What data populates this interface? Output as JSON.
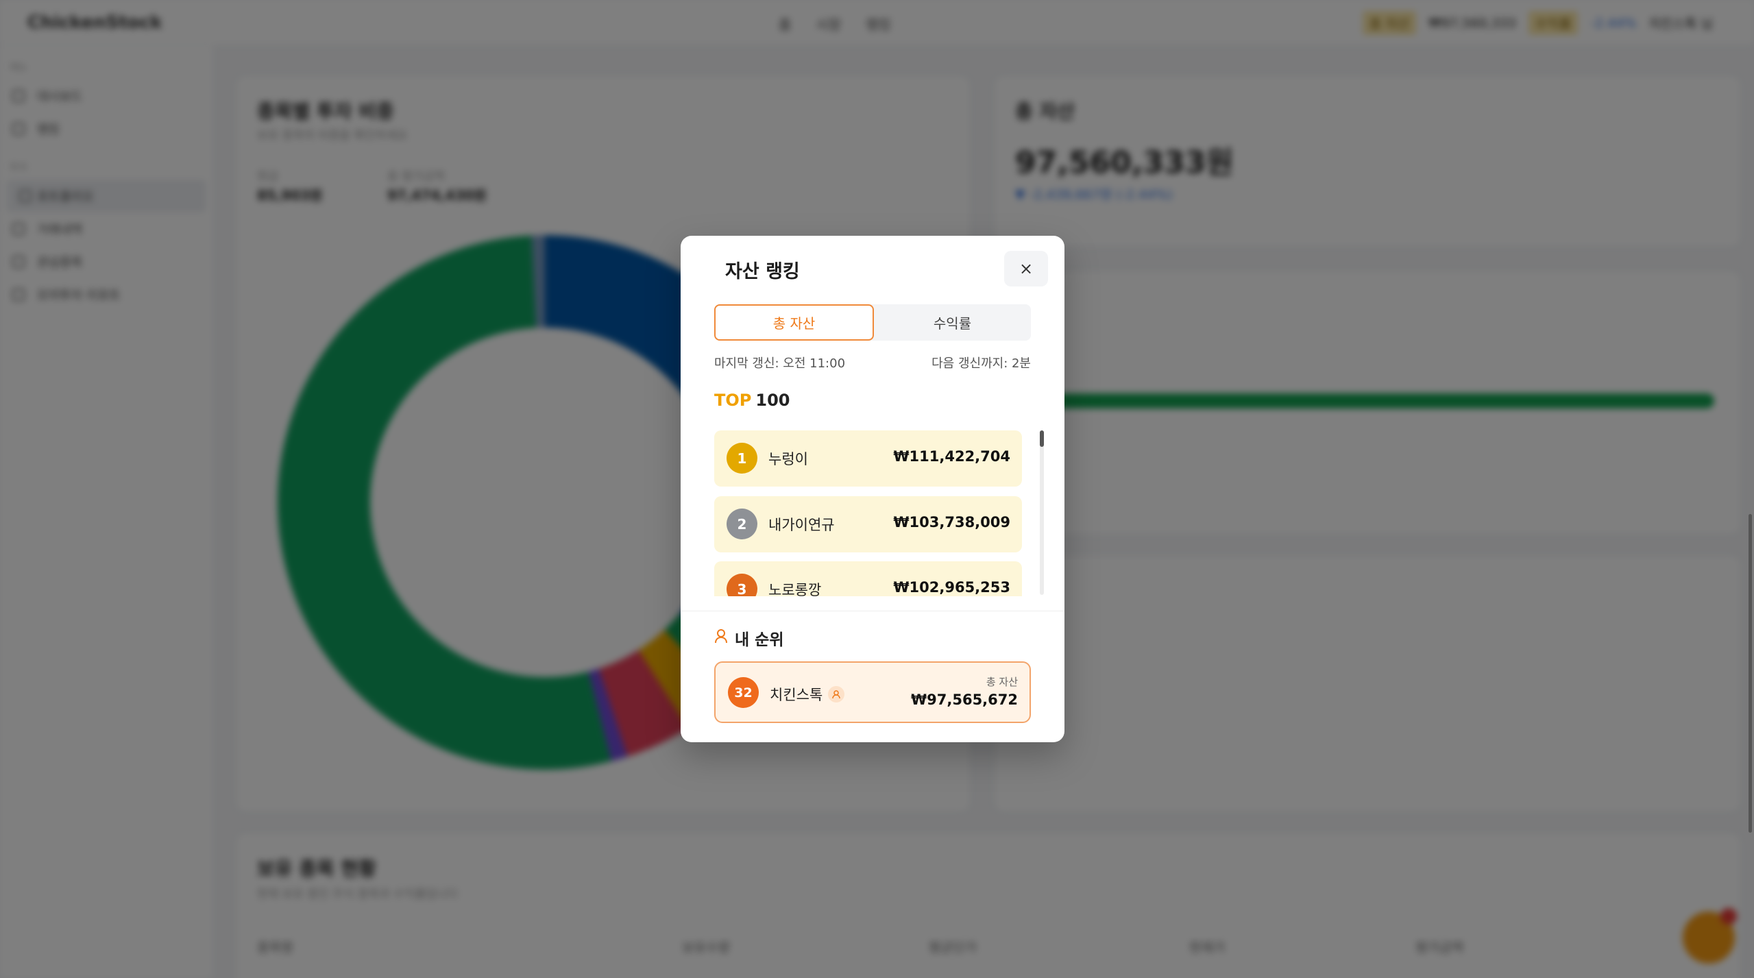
{
  "background": {
    "logo": "ChickenStock",
    "top_nav": [
      "홈",
      "시장",
      "랭킹"
    ],
    "top_right": {
      "badge_1": "총 자산",
      "total": "₩97,560,333",
      "badge_2": "수익률",
      "rate": "-2.44%",
      "user": "치킨스톡 님"
    },
    "sidebar": {
      "sections": [
        {
          "label": "메뉴",
          "items": [
            "대시보드",
            "랭킹"
          ]
        },
        {
          "label": "투자",
          "items": [
            "포트폴리오",
            "거래내역",
            "관심종목",
            "모의투자 리포트"
          ]
        }
      ]
    },
    "portfolio_card": {
      "title": "종목별 투자 비중",
      "subtitle": "보유 종목의 비중을 확인하세요",
      "cash_label": "현금",
      "cash_value": "85,903원",
      "stock_label": "총 평가금액",
      "stock_value": "97,474,430원"
    },
    "asset_card": {
      "title": "총 자산",
      "value": "97,560,333원",
      "change": "▼ -2,439,667원 (-2.44%)"
    },
    "holdings": {
      "title": "보유 종목 현황",
      "subtitle": "현재 보유 중인 주식 종목과 수익률입니다",
      "columns": [
        "종목명",
        "보유수량",
        "평균단가",
        "현재가",
        "평가금액"
      ]
    }
  },
  "modal": {
    "title": "자산 랭킹",
    "close_icon": "close-icon",
    "tabs": [
      {
        "label": "총 자산",
        "active": true
      },
      {
        "label": "수익률",
        "active": false
      }
    ],
    "last_update": "마지막 갱신: 오전 11:00",
    "next_update": "다음 갱신까지: 2분",
    "top_label_prefix": "TOP",
    "top_label_count": "100",
    "rankings": [
      {
        "rank": "1",
        "name": "누렁이",
        "value": "₩111,422,704",
        "badge_color": "#e3a800"
      },
      {
        "rank": "2",
        "name": "내가이연규",
        "value": "₩103,738,009",
        "badge_color": "#8e9196"
      },
      {
        "rank": "3",
        "name": "노로롱깡",
        "value": "₩102,965,253",
        "badge_color": "#e0691c"
      }
    ],
    "my_rank": {
      "title": "내 순위",
      "rank": "32",
      "name": "치킨스톡",
      "caption": "총 자산",
      "value": "₩97,565,672"
    }
  },
  "colors": {
    "accent": "#ef7a1a",
    "top_yellow": "#f0a000",
    "rank_item_bg": "#fdf6d8",
    "my_card_bg": "#fff3e6"
  }
}
